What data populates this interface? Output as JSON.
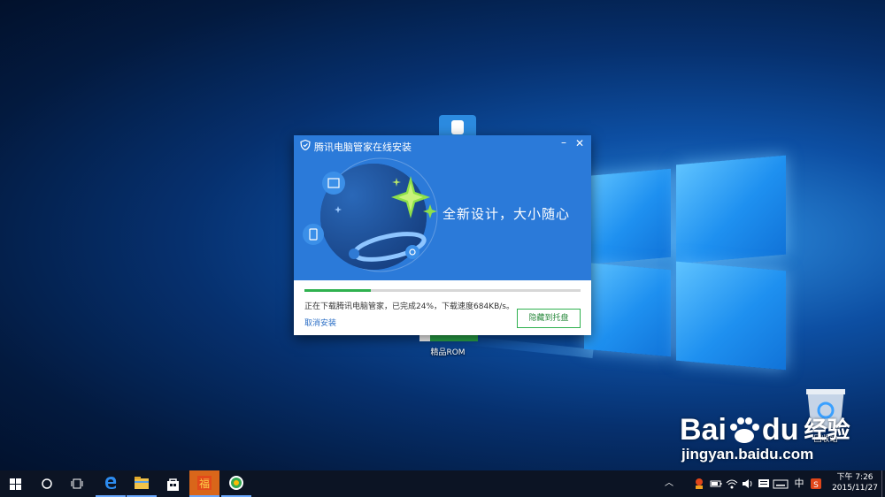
{
  "desktop": {
    "icons": [
      {
        "label": ""
      },
      {
        "label": "精品ROM"
      },
      {
        "label": "回收站"
      }
    ]
  },
  "dialog": {
    "title": "腾讯电脑管家在线安装",
    "slogan": "全新设计，大小随心",
    "progress_percent": 24,
    "status": "正在下载腾讯电脑管家，已完成24%，下载速度684KB/s。",
    "cancel_label": "取消安装",
    "hide_label": "隐藏到托盘",
    "accent": "#2b7ad9",
    "progress_color": "#2fb14f"
  },
  "taskbar": {
    "tray": {
      "ime_label": "中",
      "time": "下午 7:26",
      "date": "2015/11/27"
    }
  },
  "watermark": {
    "brand": "Bai du 经验",
    "url": "jingyan.baidu.com"
  }
}
